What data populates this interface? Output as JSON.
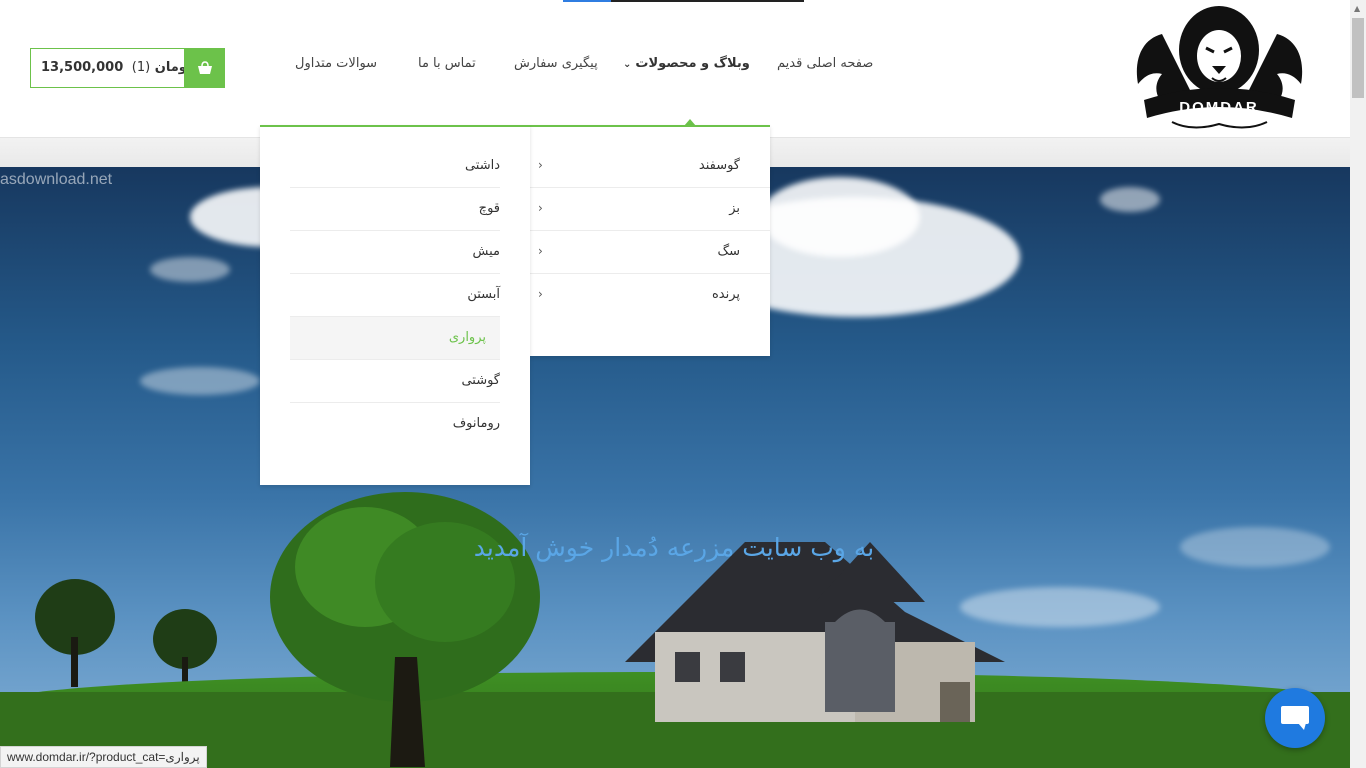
{
  "header": {
    "logo_text": "DOMDAR",
    "nav": {
      "home": "صفحه اصلی قدیم",
      "blog_products": "وبلاگ و محصولات",
      "order_tracking": "پیگیری سفارش",
      "contact": "تماس با ما",
      "faq": "سوالات متداول"
    },
    "cart": {
      "count": "(1)",
      "total": "13,500,000 تومان"
    }
  },
  "dropdown": {
    "categories": [
      "گوسفند",
      "بز",
      "سگ",
      "پرنده"
    ],
    "subcategories": [
      "داشتی",
      "قوچ",
      "میش",
      "آبستن",
      "پرواری",
      "گوشتی",
      "رومانوف"
    ],
    "active_subcategory": "پرواری"
  },
  "hero": {
    "watermark": "asdownload.net",
    "title": "به وب سایت مزرعه دُمدار خوش آمدید"
  },
  "status_url": "www.domdar.ir/?product_cat=پرواری",
  "colors": {
    "accent": "#6cc24a",
    "chat": "#1f7ae0",
    "hero_title": "#5aa6e6"
  }
}
